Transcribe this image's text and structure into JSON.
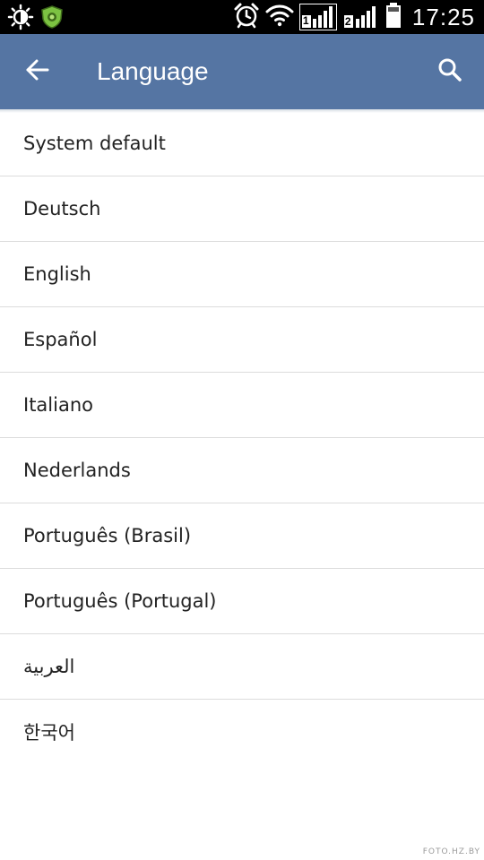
{
  "status_bar": {
    "time": "17:25",
    "sim1_label": "1",
    "sim2_label": "2",
    "icons": [
      "brightness-icon",
      "security-shield-icon",
      "alarm-icon",
      "wifi-icon",
      "signal-sim1-icon",
      "signal-sim2-icon",
      "battery-icon"
    ]
  },
  "app_bar": {
    "title": "Language",
    "back_icon": "arrow-back-icon",
    "search_icon": "search-icon",
    "background_color": "#5575a3"
  },
  "languages": [
    {
      "label": "System default"
    },
    {
      "label": "Deutsch"
    },
    {
      "label": "English"
    },
    {
      "label": "Español"
    },
    {
      "label": "Italiano"
    },
    {
      "label": "Nederlands"
    },
    {
      "label": "Português (Brasil)"
    },
    {
      "label": "Português (Portugal)"
    },
    {
      "label": "العربية"
    },
    {
      "label": "한국어"
    }
  ],
  "watermark": "FOTO.HZ.BY"
}
